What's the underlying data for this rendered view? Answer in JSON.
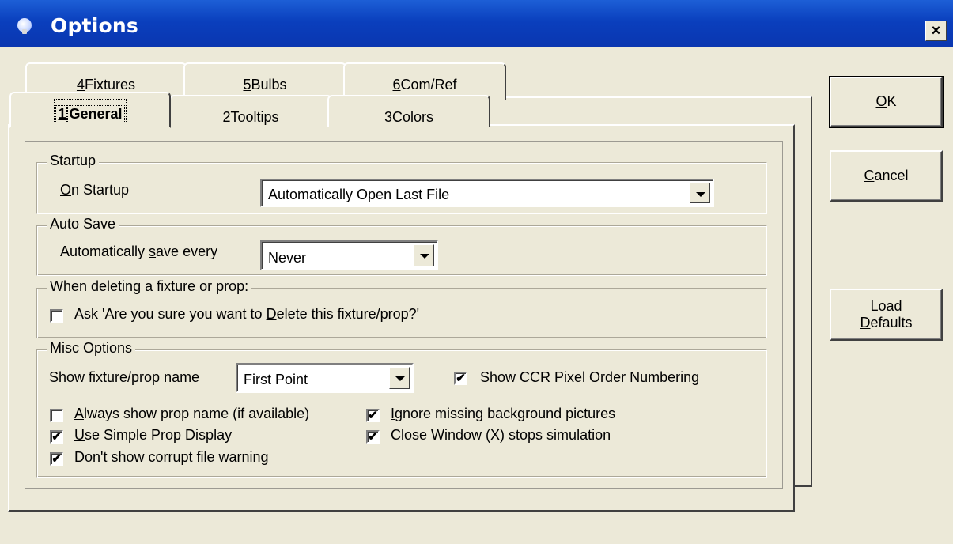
{
  "window": {
    "title": "Options",
    "close_label": "×"
  },
  "tabs_back": [
    {
      "pre": "",
      "key": "4",
      "post": " Fixtures"
    },
    {
      "pre": "",
      "key": "5",
      "post": " Bulbs"
    },
    {
      "pre": "",
      "key": "6",
      "post": " Com/Ref"
    }
  ],
  "tabs_front": [
    {
      "pre": "",
      "key": "1",
      "post": " General"
    },
    {
      "pre": "",
      "key": "2",
      "post": " Tooltips"
    },
    {
      "pre": "",
      "key": "3",
      "post": " Colors"
    }
  ],
  "startup": {
    "legend": "Startup",
    "on_startup_key": "O",
    "on_startup_rest": "n Startup",
    "selected": "Automatically Open Last File"
  },
  "autosave": {
    "legend": "Auto Save",
    "label_pre": "Automatically ",
    "label_key": "s",
    "label_post": "ave every",
    "selected": "Never"
  },
  "delete": {
    "legend": "When deleting a fixture or prop:",
    "ask_pre": "Ask 'Are you sure you want to ",
    "ask_key": "D",
    "ask_post": "elete this fixture/prop?'",
    "ask_checked": ""
  },
  "misc": {
    "legend": "Misc Options",
    "show_name_pre": "Show fixture/prop ",
    "show_name_key": "n",
    "show_name_post": "ame",
    "show_name_selected": "First Point",
    "ccr_pre": "Show CCR ",
    "ccr_key": "P",
    "ccr_post": "ixel Order Numbering",
    "ccr_checked": "✔",
    "always_pre": "",
    "always_key": "A",
    "always_post": "lways show prop name (if available)",
    "always_checked": "",
    "simple_key": "U",
    "simple_post": "se Simple Prop Display",
    "simple_checked": "✔",
    "corrupt_label": "Don't show corrupt file warning",
    "corrupt_checked": "✔",
    "ignore_key": "I",
    "ignore_post": "gnore missing background pictures",
    "ignore_checked": "✔",
    "close_label": "Close Window (X) stops simulation",
    "close_checked": "✔"
  },
  "buttons": {
    "ok_key": "O",
    "ok_rest": "K",
    "cancel_key": "C",
    "cancel_rest": "ancel",
    "load_line1": "Load",
    "load_key": "D",
    "load_rest": "efaults"
  }
}
